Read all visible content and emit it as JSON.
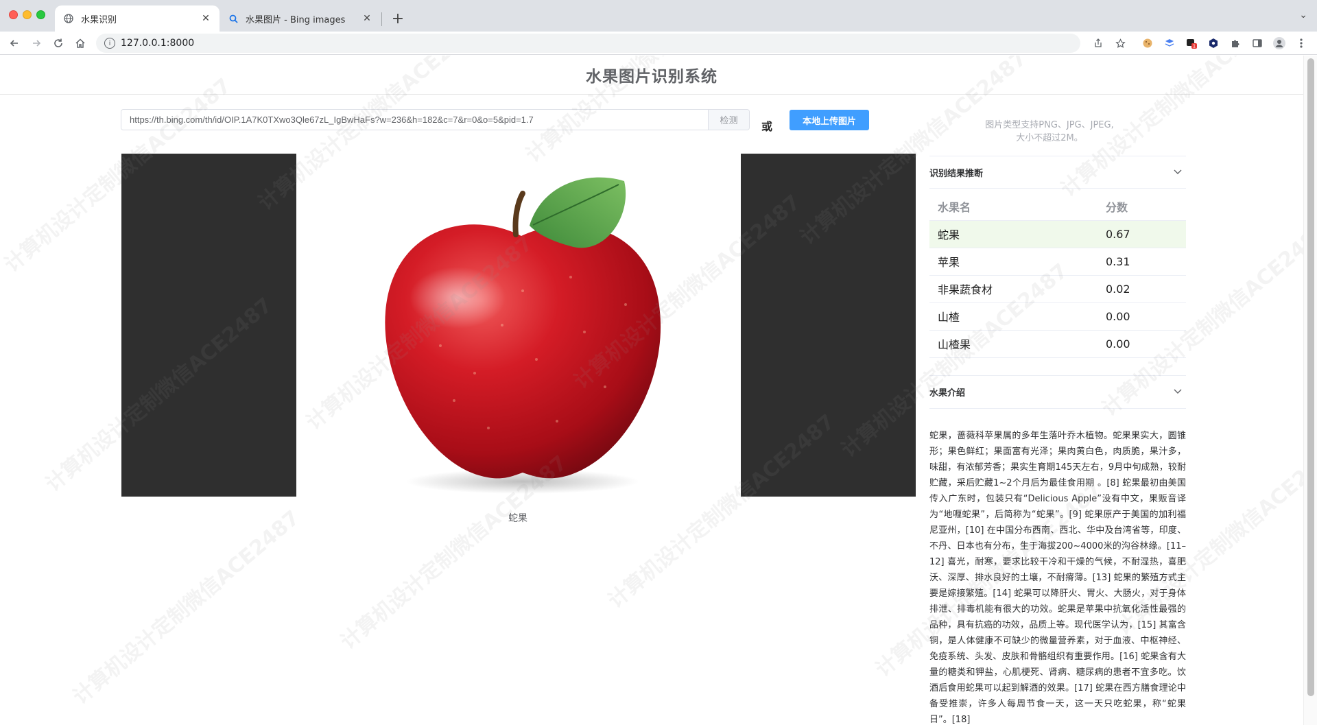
{
  "browser": {
    "tabs": [
      {
        "title": "水果识别",
        "icon": "globe-icon",
        "active": true
      },
      {
        "title": "水果图片 - Bing images",
        "icon": "search-icon",
        "active": false
      }
    ],
    "new_tab_symbol": "+",
    "address": "127.0.0.1:8000"
  },
  "page": {
    "title": "水果图片识别系统",
    "url_input_value": "https://th.bing.com/th/id/OIP.1A7K0TXwo3Qle67zL_IgBwHaFs?w=236&h=182&c=7&r=0&o=5&pid=1.7",
    "detect_label": "检测",
    "or_label": "或",
    "upload_label": "本地上传图片",
    "upload_tip_line1": "图片类型支持PNG、JPG、JPEG,",
    "upload_tip_line2": "大小不超过2M。",
    "prediction_caption": "蛇果",
    "watermark": "计算机设计定制微信ACE2487"
  },
  "results": {
    "section_title": "识别结果推断",
    "columns": [
      "水果名",
      "分数"
    ],
    "rows": [
      {
        "name": "蛇果",
        "score": "0.67"
      },
      {
        "name": "苹果",
        "score": "0.31"
      },
      {
        "name": "非果蔬食材",
        "score": "0.02"
      },
      {
        "name": "山楂",
        "score": "0.00"
      },
      {
        "name": "山楂果",
        "score": "0.00"
      }
    ],
    "highlight_color": "#f0f9eb"
  },
  "intro": {
    "section_title": "水果介绍",
    "text": "蛇果，蔷薇科苹果属的多年生落叶乔木植物。蛇果果实大，圆锥形；果色鲜红；果面富有光泽；果肉黄白色，肉质脆，果汁多，味甜，有浓郁芳香；果实生育期145天左右，9月中旬成熟，较耐贮藏，采后贮藏1~2个月后为最佳食用期 。[8] 蛇果最初由美国传入广东时，包装只有“Delicious Apple”没有中文，果贩音译为“地喱蛇果”，后简称为“蛇果”。[9] 蛇果原产于美国的加利福尼亚州，[10] 在中国分布西南、西北、华中及台湾省等，印度、不丹、日本也有分布，生于海拔200~4000米的沟谷林缘。[11–12] 喜光，耐寒，要求比较干冷和干燥的气候，不耐湿热，喜肥沃、深厚、排水良好的土壤，不耐瘠薄。[13] 蛇果的繁殖方式主要是嫁接繁殖。[14] 蛇果可以降肝火、胃火、大肠火，对于身体排泄、排毒机能有很大的功效。蛇果是苹果中抗氧化活性最强的品种，具有抗癌的功效，品质上等。现代医学认为，[15] 其富含铜，是人体健康不可缺少的微量营养素，对于血液、中枢神经、免疫系统、头发、皮肤和骨骼组织有重要作用。[16] 蛇果含有大量的糖类和钾盐，心肌梗死、肾病、糖尿病的患者不宜多吃。饮酒后食用蛇果可以起到解酒的效果。[17] 蛇果在西方膳食理论中备受推崇，许多人每周节食一天，这一天只吃蛇果，称“蛇果日”。[18]"
  },
  "colors": {
    "primary_button": "#409eff",
    "title_text": "#606266"
  }
}
